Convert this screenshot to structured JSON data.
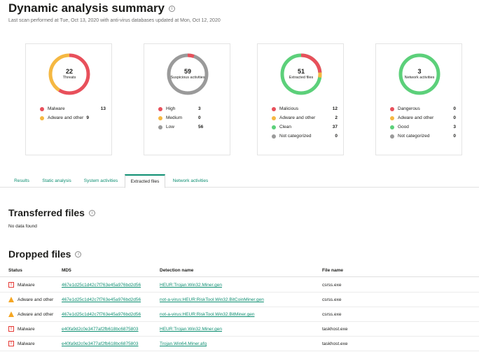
{
  "header": {
    "title": "Dynamic analysis summary",
    "subtitle": "Last scan performed at Tue, Oct 13, 2020 with anti-virus databases updated at Mon, Oct 12, 2020"
  },
  "cards": [
    {
      "count": "22",
      "label": "Threats",
      "legend": [
        {
          "name": "Malware",
          "value": "13",
          "color": "#e8505b"
        },
        {
          "name": "Adware and other",
          "value": "9",
          "color": "#f5b842"
        }
      ]
    },
    {
      "count": "59",
      "label": "Suspicious activities",
      "legend": [
        {
          "name": "High",
          "value": "3",
          "color": "#e8505b"
        },
        {
          "name": "Medium",
          "value": "0",
          "color": "#f5b842"
        },
        {
          "name": "Low",
          "value": "56",
          "color": "#9a9a9a"
        }
      ]
    },
    {
      "count": "51",
      "label": "Extracted files",
      "legend": [
        {
          "name": "Malicious",
          "value": "12",
          "color": "#e8505b"
        },
        {
          "name": "Adware and other",
          "value": "2",
          "color": "#f5b842"
        },
        {
          "name": "Clean",
          "value": "37",
          "color": "#5cd07a"
        },
        {
          "name": "Not categorized",
          "value": "0",
          "color": "#9a9a9a"
        }
      ]
    },
    {
      "count": "3",
      "label": "Network activities",
      "legend": [
        {
          "name": "Dangerous",
          "value": "0",
          "color": "#e8505b"
        },
        {
          "name": "Adware and other",
          "value": "0",
          "color": "#f5b842"
        },
        {
          "name": "Good",
          "value": "3",
          "color": "#5cd07a"
        },
        {
          "name": "Not categorized",
          "value": "0",
          "color": "#9a9a9a"
        }
      ]
    }
  ],
  "tabs": [
    {
      "label": "Results"
    },
    {
      "label": "Static analysis"
    },
    {
      "label": "System activities"
    },
    {
      "label": "Extracted files",
      "active": true
    },
    {
      "label": "Network activities"
    }
  ],
  "transferred": {
    "title": "Transferred files",
    "empty_text": "No data found"
  },
  "dropped": {
    "title": "Dropped files",
    "columns": [
      "Status",
      "MD5",
      "Detection name",
      "File name"
    ],
    "rows": [
      {
        "status": "Malware",
        "md5": "467e1d25c1d42c7f763e45a976bd2d56",
        "detection": "HEUR:Trojan.Win32.Miner.gen",
        "file": "csrss.exe"
      },
      {
        "status": "Adware and other",
        "md5": "467e1d25c1d42c7f763e45a976bd2d56",
        "detection": "not-a-virus:HEUR:RiskTool.Win32.BitCoinMiner.gen",
        "file": "csrss.exe"
      },
      {
        "status": "Adware and other",
        "md5": "467e1d25c1d42c7f763e45a976bd2d56",
        "detection": "not-a-virus:HEUR:RiskTool.Win32.BitMiner.gen",
        "file": "csrss.exe"
      },
      {
        "status": "Malware",
        "md5": "e40fa9d2c0e3477af2fb618bc6875803",
        "detection": "HEUR:Trojan.Win32.Miner.gen",
        "file": "taskhost.exe"
      },
      {
        "status": "Malware",
        "md5": "e40fa9d2c0e3477af2fb618bc6875803",
        "detection": "Trojan.Win64.Miner.afq",
        "file": "taskhost.exe"
      }
    ]
  }
}
